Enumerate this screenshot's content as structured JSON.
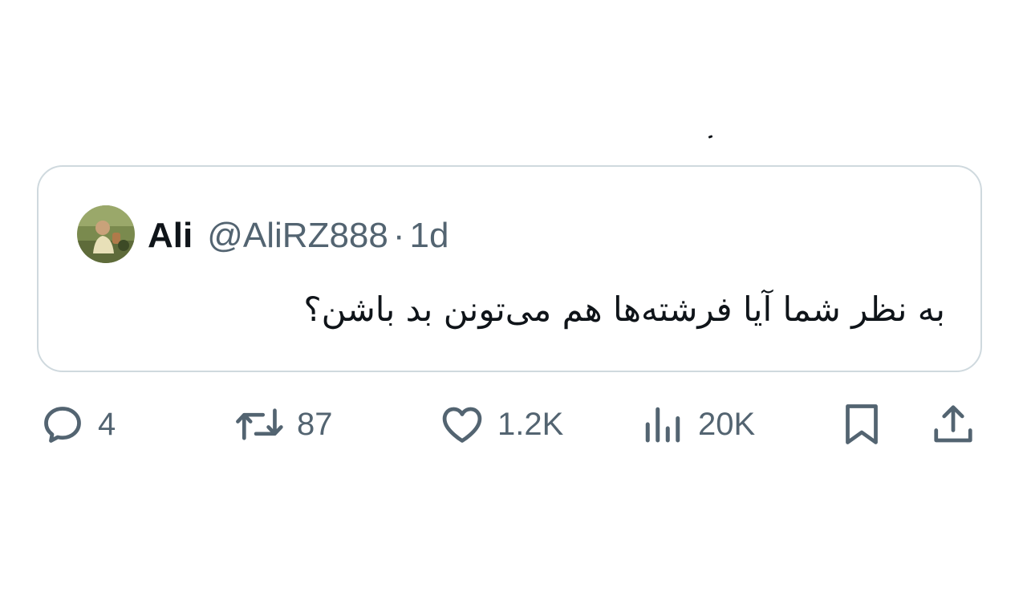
{
  "tweet": {
    "author": {
      "display_name": "Ali",
      "handle": "@AliRZ888",
      "separator": "·",
      "time": "1d"
    },
    "text": "به نظر شما آیا فرشته‌ها هم می‌تونن بد باشن؟"
  },
  "actions": {
    "reply": {
      "icon": "reply-icon",
      "count": "4"
    },
    "retweet": {
      "icon": "retweet-icon",
      "count": "87"
    },
    "like": {
      "icon": "heart-icon",
      "count": "1.2K"
    },
    "views": {
      "icon": "analytics-icon",
      "count": "20K"
    },
    "bookmark": {
      "icon": "bookmark-icon"
    },
    "share": {
      "icon": "share-icon"
    }
  },
  "colors": {
    "text_primary": "#0f1419",
    "text_secondary": "#536471",
    "border": "#cfd9de"
  }
}
